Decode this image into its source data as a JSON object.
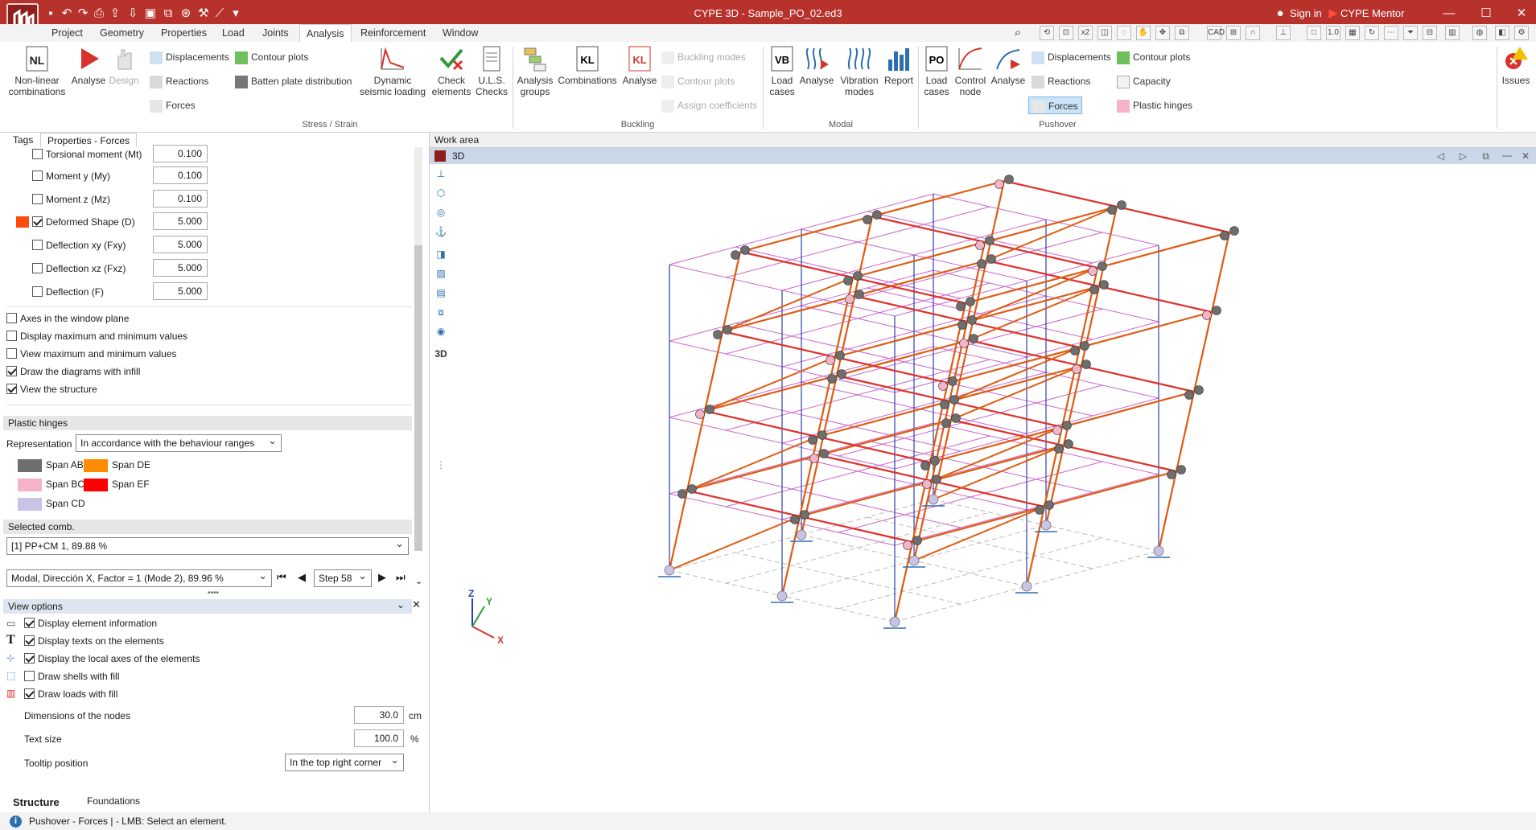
{
  "window": {
    "title": "CYPE 3D - Sample_PO_02.ed3",
    "signin": "Sign in",
    "mentor": "CYPE Mentor",
    "brand_color": "#b8322c"
  },
  "menu": {
    "tabs": [
      "Project",
      "Geometry",
      "Properties",
      "Load",
      "Joints",
      "Analysis",
      "Reinforcement",
      "Window"
    ],
    "active": "Analysis"
  },
  "ribbon": {
    "nonlinear": "Non-linear combinations",
    "analyse": "Analyse",
    "design": "Design",
    "displacements": "Displacements",
    "reactions": "Reactions",
    "forces": "Forces",
    "contour_plots": "Contour plots",
    "batten": "Batten plate distribution",
    "dynamic": "Dynamic seismic loading",
    "check": "Check elements",
    "uls": "U.L.S. Checks",
    "stress_group": "Stress / Strain",
    "analysis_groups": "Analysis groups",
    "combinations": "Combinations",
    "analyse_buckling": "Analyse",
    "buckling_modes": "Buckling modes",
    "contour_plots_b": "Contour plots",
    "assign_coeff": "Assign coefficients",
    "buckling_group": "Buckling",
    "load_cases": "Load cases",
    "analyse_modal": "Analyse",
    "vibration_modes": "Vibration modes",
    "report": "Report",
    "modal_group": "Modal",
    "load_cases_po": "Load cases",
    "control_node": "Control node",
    "analyse_po": "Analyse",
    "displacements_po": "Displacements",
    "reactions_po": "Reactions",
    "forces_po": "Forces",
    "contour_plots_po": "Contour plots",
    "capacity": "Capacity",
    "plastic_hinges": "Plastic hinges",
    "pushover_group": "Pushover",
    "issues": "Issues",
    "nl_label": "NL",
    "kl_label": "KL",
    "vb_label": "VB",
    "po_label": "PO"
  },
  "left": {
    "tabs": [
      "Tags",
      "Properties - Forces"
    ],
    "force_rows": [
      {
        "label": "Torsional moment (Mt)",
        "value": "0.100",
        "checked": false
      },
      {
        "label": "Moment y (My)",
        "value": "0.100",
        "checked": false
      },
      {
        "label": "Moment z (Mz)",
        "value": "0.100",
        "checked": false
      },
      {
        "label": "Deformed Shape (D)",
        "value": "5.000",
        "checked": true
      },
      {
        "label": "Deflection xy (Fxy)",
        "value": "5.000",
        "checked": false
      },
      {
        "label": "Deflection xz (Fxz)",
        "value": "5.000",
        "checked": false
      },
      {
        "label": "Deflection (F)",
        "value": "5.000",
        "checked": false
      }
    ],
    "options": [
      {
        "label": "Axes in the window plane",
        "checked": false
      },
      {
        "label": "Display maximum and minimum values",
        "checked": false
      },
      {
        "label": "View maximum and minimum values",
        "checked": false
      },
      {
        "label": "Draw the diagrams with infill",
        "checked": true
      },
      {
        "label": "View the structure",
        "checked": true
      }
    ],
    "plastic_hinges_head": "Plastic hinges",
    "representation_label": "Representation",
    "representation_value": "In accordance with the behaviour ranges",
    "spans": [
      {
        "label": "Span AB",
        "color": "#6e6e6e"
      },
      {
        "label": "Span DE",
        "color": "#ff8c00"
      },
      {
        "label": "Span BC",
        "color": "#f5b3c8"
      },
      {
        "label": "Span EF",
        "color": "#ff0000"
      },
      {
        "label": "Span CD",
        "color": "#c9c3e6"
      }
    ],
    "selected_comb_head": "Selected comb.",
    "selected_comb_value": "[1] PP+CM 1, 89.88 %",
    "modal_value": "Modal, Dirección X, Factor = 1 (Mode 2), 89.96 %",
    "step_value": "Step 58",
    "view_options_head": "View options",
    "view_options": [
      {
        "label": "Display element information",
        "checked": true
      },
      {
        "label": "Display texts on the elements",
        "checked": true
      },
      {
        "label": "Display the local axes of the elements",
        "checked": true
      },
      {
        "label": "Draw shells with fill",
        "checked": false
      },
      {
        "label": "Draw loads with fill",
        "checked": true
      }
    ],
    "node_dim_label": "Dimensions of the nodes",
    "node_dim_value": "30.0",
    "node_dim_unit": "cm",
    "text_size_label": "Text size",
    "text_size_value": "100.0",
    "text_size_unit": "%",
    "tooltip_label": "Tooltip position",
    "tooltip_value": "In the top right corner",
    "bottom_tabs": [
      "Structure",
      "Foundations"
    ]
  },
  "work_area": {
    "title": "Work area",
    "view_name": "3D",
    "axis_x": "X",
    "axis_y": "Y",
    "axis_z": "Z"
  },
  "status": {
    "text": "Pushover - Forces | - LMB: Select an element."
  },
  "colors": {
    "deformed": "#e05a10",
    "undeformed": "#cc66cc",
    "columns": "#2b3fb0",
    "accent": "#2e6fb0"
  }
}
